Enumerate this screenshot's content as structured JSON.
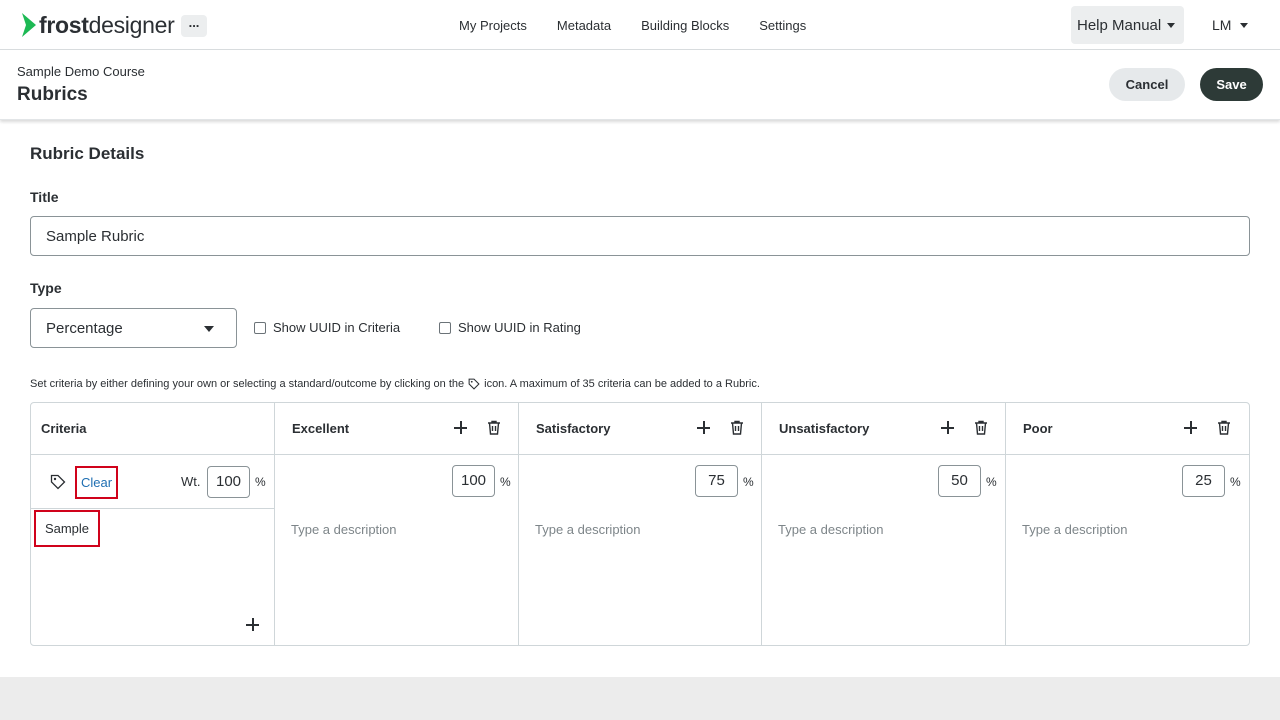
{
  "app": {
    "logo_bold": "frost",
    "logo_rest": "designer",
    "more_label": "...",
    "nav": [
      "My Projects",
      "Metadata",
      "Building Blocks",
      "Settings"
    ],
    "help_label": "Help Manual",
    "user_initials": "LM"
  },
  "page": {
    "course": "Sample Demo Course",
    "title": "Rubrics",
    "cancel_label": "Cancel",
    "save_label": "Save"
  },
  "form": {
    "section_title": "Rubric Details",
    "title_label": "Title",
    "title_value": "Sample Rubric",
    "type_label": "Type",
    "type_value": "Percentage",
    "show_uuid_criteria": "Show UUID in Criteria",
    "show_uuid_rating": "Show UUID in Rating",
    "hint_before": "Set criteria by either defining your own or selecting a standard/outcome by clicking on the",
    "hint_after": "icon. A maximum of 35 criteria can be added to a Rubric."
  },
  "table": {
    "criteria_header": "Criteria",
    "clear_label": "Clear",
    "weight_label": "Wt.",
    "weight_value": "100",
    "percent_sign": "%",
    "criterion_name": "Sample",
    "description_placeholder": "Type a description",
    "ratings": [
      {
        "name": "Excellent",
        "value": "100"
      },
      {
        "name": "Satisfactory",
        "value": "75"
      },
      {
        "name": "Unsatisfactory",
        "value": "50"
      },
      {
        "name": "Poor",
        "value": "25"
      }
    ]
  },
  "colors": {
    "primary_dark": "#2d3a37",
    "accent_green": "#1db954",
    "highlight_red": "#d0021b",
    "link_blue": "#1f6fb2"
  }
}
